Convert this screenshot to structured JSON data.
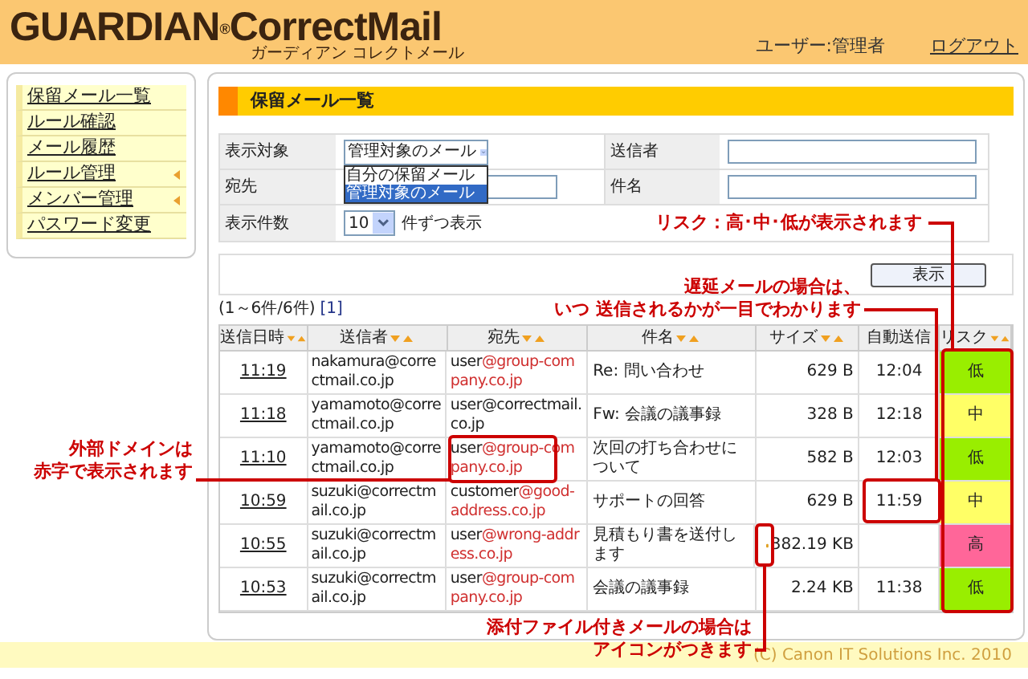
{
  "header": {
    "logo_main": "GUARDIAN",
    "logo_mark": "®",
    "logo_second": "CorrectMail",
    "logo_sub": "ガーディアン コレクトメール",
    "user": "ユーザー:管理者",
    "logout": "ログアウト"
  },
  "sidebar": {
    "items": [
      {
        "label": "保留メール一覧",
        "submenu": false
      },
      {
        "label": "ルール確認",
        "submenu": false
      },
      {
        "label": "メール履歴",
        "submenu": false
      },
      {
        "label": "ルール管理",
        "submenu": true
      },
      {
        "label": "メンバー管理",
        "submenu": true
      },
      {
        "label": "パスワード変更",
        "submenu": false
      }
    ]
  },
  "panel": {
    "title": "保留メール一覧",
    "filters": {
      "target_label": "表示対象",
      "target_value": "管理対象のメール",
      "target_options": [
        {
          "label": "自分の保留メール",
          "selected": false
        },
        {
          "label": "管理対象のメール",
          "selected": true
        }
      ],
      "sender_label": "送信者",
      "recipient_label": "宛先",
      "subject_label": "件名",
      "count_label": "表示件数",
      "count_value": "10",
      "count_suffix": "件ずつ表示"
    },
    "show_button": "表示",
    "result_count": "(1～6件/6件)",
    "pages": [
      {
        "label": "[1]"
      }
    ],
    "table": {
      "columns": [
        {
          "label": "送信日時",
          "sortable": true
        },
        {
          "label": "送信者",
          "sortable": true
        },
        {
          "label": "宛先",
          "sortable": true
        },
        {
          "label": "件名",
          "sortable": true
        },
        {
          "label": "サイズ",
          "sortable": true
        },
        {
          "label": "自動送信",
          "sortable": false
        },
        {
          "label": "リスク",
          "sortable": true
        }
      ],
      "rows": [
        {
          "time": "11:19",
          "sender": "nakamura@correctmail.co.jp",
          "recipient_user": "user",
          "recipient_domain": "@group-company.co.jp",
          "external": true,
          "subject": "Re: 問い合わせ",
          "attachment": false,
          "size": "629 B",
          "auto_send": "12:04",
          "risk": {
            "label": "低",
            "color": "#99ee00"
          }
        },
        {
          "time": "11:18",
          "sender": "yamamoto@correctmail.co.jp",
          "recipient_user": "user",
          "recipient_domain": "@correctmail.co.jp",
          "external": false,
          "subject": "Fw: 会議の議事録",
          "attachment": false,
          "size": "328 B",
          "auto_send": "12:18",
          "risk": {
            "label": "中",
            "color": "#ffff66"
          }
        },
        {
          "time": "11:10",
          "sender": "yamamoto@correctmail.co.jp",
          "recipient_user": "user",
          "recipient_domain": "@group-company.co.jp",
          "external": true,
          "subject": "次回の打ち合わせについて",
          "attachment": false,
          "size": "582 B",
          "auto_send": "12:03",
          "risk": {
            "label": "低",
            "color": "#99ee00"
          }
        },
        {
          "time": "10:59",
          "sender": "suzuki@correctmail.co.jp",
          "recipient_user": "customer",
          "recipient_domain": "@good-address.co.jp",
          "external": true,
          "subject": "サポートの回答",
          "attachment": false,
          "size": "629 B",
          "auto_send": "11:59",
          "risk": {
            "label": "中",
            "color": "#ffff66"
          }
        },
        {
          "time": "10:55",
          "sender": "suzuki@correctmail.co.jp",
          "recipient_user": "user",
          "recipient_domain": "@wrong-address.co.jp",
          "external": true,
          "subject": "見積もり書を送付します",
          "attachment": true,
          "size": "382.19 KB",
          "risk": {
            "label": "高",
            "color": "#ff6699"
          }
        },
        {
          "time": "10:53",
          "sender": "suzuki@correctmail.co.jp",
          "recipient_user": "user",
          "recipient_domain": "@group-company.co.jp",
          "external": true,
          "subject": "会議の議事録",
          "attachment": false,
          "size": "2.24 KB",
          "auto_send": "11:38",
          "risk": {
            "label": "低",
            "color": "#99ee00"
          }
        }
      ]
    }
  },
  "annotations": [
    {
      "lines": [
        "リスク：高･中･低が表示されます"
      ]
    },
    {
      "lines": [
        "遅延メールの場合は、",
        "いつ 送信されるかが一目でわかります"
      ]
    },
    {
      "lines": [
        "外部ドメインは",
        "赤字で表示されます"
      ]
    },
    {
      "lines": [
        "添付ファイル付きメールの場合は",
        "アイコンがつきます"
      ]
    }
  ],
  "footer": {
    "copyright": "(C) Canon IT Solutions Inc. 2010"
  }
}
